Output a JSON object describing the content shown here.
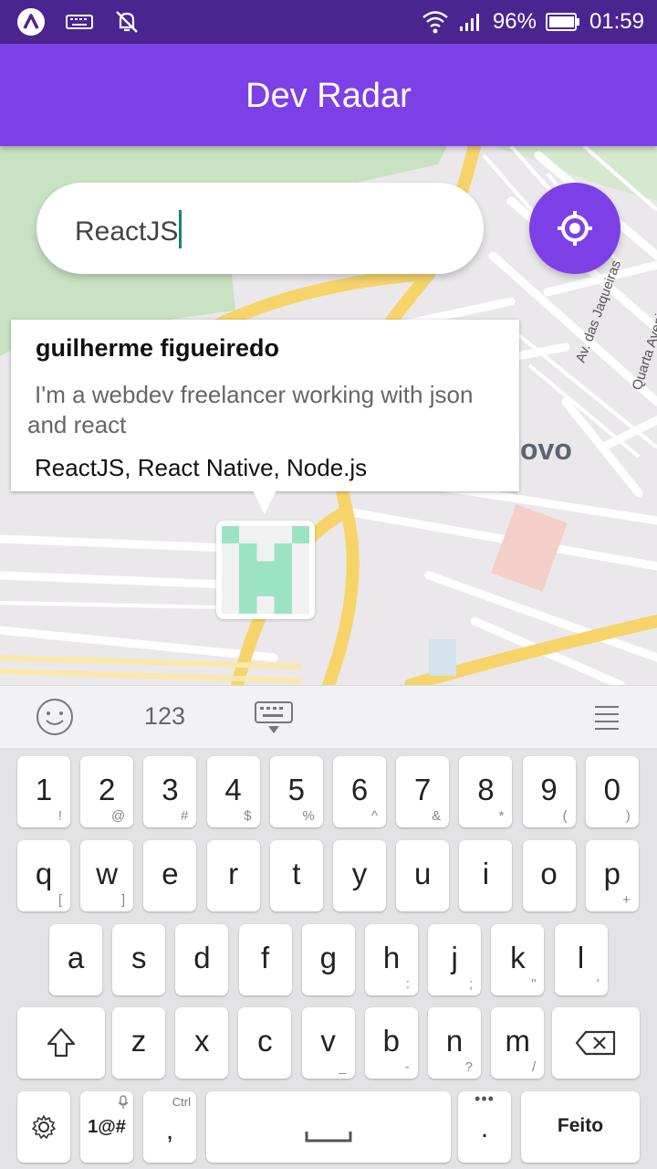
{
  "status_bar": {
    "battery": "96%",
    "time": "01:59"
  },
  "app": {
    "title": "Dev Radar"
  },
  "search": {
    "value": "ReactJS"
  },
  "map": {
    "place_label": "ovo",
    "street_1": "Av. das Jaqueiras",
    "street_2": "Quarta Avenida"
  },
  "callout": {
    "name": "guilherme figueiredo",
    "bio": "I'm a webdev freelancer working with json and react",
    "techs": "ReactJS, React Native, Node.js"
  },
  "keyboard": {
    "toolbar": {
      "numbers": "123"
    },
    "row_numbers": [
      {
        "m": "1",
        "s": "!"
      },
      {
        "m": "2",
        "s": "@"
      },
      {
        "m": "3",
        "s": "#"
      },
      {
        "m": "4",
        "s": "$"
      },
      {
        "m": "5",
        "s": "%"
      },
      {
        "m": "6",
        "s": "^"
      },
      {
        "m": "7",
        "s": "&"
      },
      {
        "m": "8",
        "s": "*"
      },
      {
        "m": "9",
        "s": "("
      },
      {
        "m": "0",
        "s": ")"
      }
    ],
    "row_1": [
      {
        "m": "q",
        "s": "["
      },
      {
        "m": "w",
        "s": "]"
      },
      {
        "m": "e",
        "s": ""
      },
      {
        "m": "r",
        "s": ""
      },
      {
        "m": "t",
        "s": ""
      },
      {
        "m": "y",
        "s": ""
      },
      {
        "m": "u",
        "s": ""
      },
      {
        "m": "i",
        "s": ""
      },
      {
        "m": "o",
        "s": ""
      },
      {
        "m": "p",
        "s": "+"
      }
    ],
    "row_2": [
      {
        "m": "a",
        "s": ""
      },
      {
        "m": "s",
        "s": ""
      },
      {
        "m": "d",
        "s": ""
      },
      {
        "m": "f",
        "s": ""
      },
      {
        "m": "g",
        "s": ""
      },
      {
        "m": "h",
        "s": ":"
      },
      {
        "m": "j",
        "s": ";"
      },
      {
        "m": "k",
        "s": "\""
      },
      {
        "m": "l",
        "s": "'"
      }
    ],
    "row_3": [
      {
        "m": "z",
        "s": ""
      },
      {
        "m": "x",
        "s": ""
      },
      {
        "m": "c",
        "s": ""
      },
      {
        "m": "v",
        "s": "_"
      },
      {
        "m": "b",
        "s": "-"
      },
      {
        "m": "n",
        "s": "?"
      },
      {
        "m": "m",
        "s": "/"
      }
    ],
    "symbols_key": "1@#",
    "comma_key": ",",
    "ctrl_hint": "Ctrl",
    "period_key": ".",
    "done_key": "Feito"
  },
  "colors": {
    "primary": "#7d40e7",
    "status_bar": "#4b258f",
    "caret": "#16827b",
    "avatar_green": "#9be3c3"
  }
}
